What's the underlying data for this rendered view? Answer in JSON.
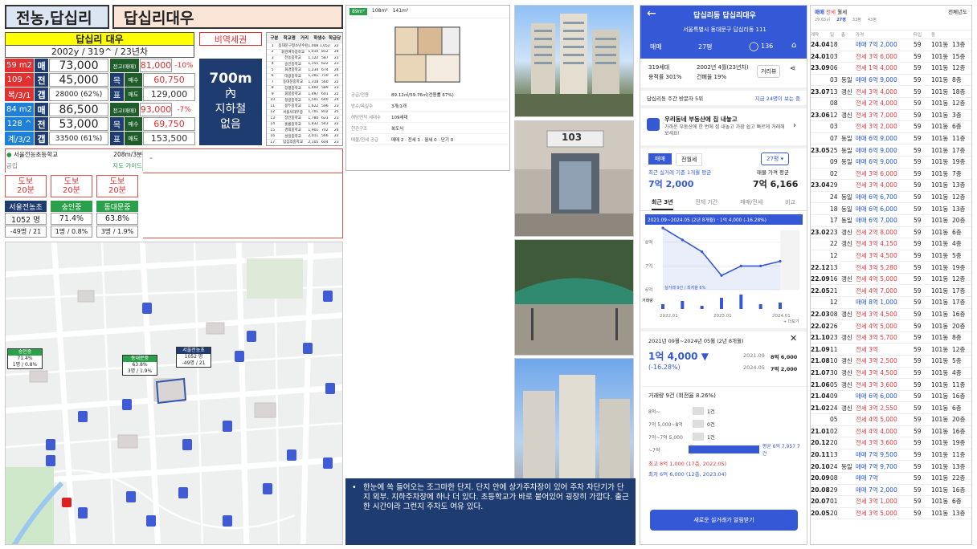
{
  "header": {
    "region": "전농,답십리",
    "apt": "답십리대우"
  },
  "summary": {
    "name": "답십리 대우",
    "meta": "2002y / 319^ / 23년차",
    "station_badge": "비역세권",
    "station_big": "700m",
    "station_line2": "內",
    "station_line3": "지하철",
    "station_line4": "없음"
  },
  "units": [
    {
      "size": "59 m2",
      "hh": "109 ^",
      "layout": "복/3/1",
      "r1": "매",
      "v1": "73,000",
      "r2": "전",
      "v2": "45,000",
      "r3": "갭",
      "v3": "28000 (62%)",
      "peak_label": "전고(매매)",
      "peak": "81,000",
      "pct": "-10%",
      "k2": "목",
      "kl2": "매수",
      "kv2": "60,750",
      "k3": "표",
      "kl3": "매도",
      "kv3": "129,000"
    },
    {
      "size": "84 m2",
      "hh": "128 ^",
      "layout": "계/3/2",
      "r1": "매",
      "v1": "86,500",
      "r2": "전",
      "v2": "53,000",
      "r3": "갭",
      "v3": "33500 (61%)",
      "peak_label": "전고(매매)",
      "peak": "93,000",
      "pct": "-7%",
      "k2": "목",
      "kl2": "매수",
      "kv2": "69,750",
      "k3": "표",
      "kl3": "매도",
      "kv3": "153,500"
    }
  ],
  "school": {
    "name": "서울전농초등학교",
    "type": "공립",
    "dist": "208m/3분",
    "link": "지도 가이드",
    "dash": "-"
  },
  "walk": [
    "도보\n20분",
    "도보\n20분",
    "도보\n20분"
  ],
  "schools": [
    {
      "name": "서울전농초",
      "count": "1052 명",
      "delta": "-49명 / 21"
    },
    {
      "name": "숭인중",
      "count": "71.4%",
      "delta": "1명 / 0.8%"
    },
    {
      "name": "동대문중",
      "count": "63.8%",
      "delta": "3명 / 1.9%"
    }
  ],
  "map": {
    "label1_name": "숭인중",
    "label1_a": "71.4%",
    "label1_b": "1명 / 0.8%",
    "label2_name": "동대문중",
    "label2_a": "63.8%",
    "label2_b": "3명 / 1.9%",
    "label3_name": "서울전농초",
    "label3_a": "1052 명",
    "label3_b": "-49명 / 21"
  },
  "floorplan": {
    "tab1": "89m²",
    "tab2": "108m²",
    "tab3": "141m²",
    "rows": [
      [
        "공급/전용",
        "89.12㎡/59.76㎡(전용률 67%)"
      ],
      [
        "방수/욕실수",
        "3개/1개"
      ],
      [
        "해당면적 세대수",
        "109세대"
      ],
      [
        "현관구조",
        "복도식"
      ],
      [
        "매물/전세 공급",
        "매매 2 · 전세 1 · 월세 0 · 단기 0"
      ]
    ]
  },
  "school_list": {
    "head": [
      "구분",
      "학교명",
      "거리",
      "학생수",
      "학급당"
    ],
    "rows": [
      [
        "1",
        "동대문구청소년수련관",
        "1,008",
        "1,052",
        "22"
      ],
      [
        "2",
        "휘경여자중학교",
        "1,010",
        "812",
        "24"
      ],
      [
        "3",
        "전농중학교",
        "1,122",
        "587",
        "21"
      ],
      [
        "4",
        "숭인중학교",
        "1,155",
        "622",
        "23"
      ],
      [
        "5",
        "휘경중학교",
        "1,234",
        "674",
        "24"
      ],
      [
        "6",
        "대광중학교",
        "1,301",
        "710",
        "25"
      ],
      [
        "7",
        "동대문중학교",
        "1,318",
        "560",
        "22"
      ],
      [
        "8",
        "장평중학교",
        "1,402",
        "589",
        "23"
      ],
      [
        "9",
        "휘봉중학교",
        "1,497",
        "601",
        "22"
      ],
      [
        "10",
        "청량중학교",
        "1,501",
        "640",
        "24"
      ],
      [
        "11",
        "용두중학교",
        "1,622",
        "596",
        "23"
      ],
      [
        "12",
        "서울사대부중",
        "1,701",
        "812",
        "25"
      ],
      [
        "13",
        "장안중학교",
        "1,780",
        "621",
        "23"
      ],
      [
        "14",
        "홍릉중학교",
        "1,832",
        "543",
        "22"
      ],
      [
        "15",
        "경희중학교",
        "1,901",
        "702",
        "24"
      ],
      [
        "16",
        "성일중학교",
        "2,011",
        "566",
        "22"
      ],
      [
        "17",
        "답십리중학교",
        "2,105",
        "604",
        "23"
      ]
    ]
  },
  "comment": "한눈에 쏙 들어오는 조그마한 단지. 단지 안에 상가주차장이 있어 주차 차단기가 단지 외부. 지하주차장에 하나 더 있다. 초등학교가 바로 붙어있어 굉장히 가깝다. 출근한 시간이라 그런지 주차도 여유 있다.",
  "phone": {
    "title": "답십리동 답십리대우",
    "address": "서울특별시 동대문구 답십리동 111",
    "tabs": [
      "매매",
      "27평",
      "136"
    ],
    "info1": "319세대",
    "info2": "용적률 301%",
    "info3": "2002년 4월(23년차)",
    "info4": "건폐율 19%",
    "info_btn": "거리뷰",
    "visitors": "답십리동 주간 방문자 5위",
    "visitors_link": "지금 24명이 보는 중",
    "banner_title": "우리동네 부동산에 집 내놓고",
    "banner_sub": "가까운 부동산에 한 번에 집 내놓고 가장 쉽고 빠르게 거래해보세요!",
    "seg1": "매매",
    "seg2": "전월세",
    "pyeong": "27평",
    "recent_label": "최근 실거래 기준 1개월 평균",
    "recent_val": "7억 2,000",
    "listing_label": "매물 가격 평균",
    "listing_val": "7억 6,166",
    "ctabs": [
      "최근 3년",
      "전체 기간",
      "매매/전세",
      "비교"
    ],
    "chart_header": "2021.09~2024.05 (2년 8개월) · 1억 4,000 (-16.28%)",
    "y1": "8억",
    "y2": "7억",
    "y3": "6억",
    "x1": "2022.01",
    "x2": "2023.01",
    "x3": "2024.01",
    "legend": "실거래 9건 / 최저율 6%",
    "vol": "거래량",
    "more": "+ 더보기",
    "period": "2021년 09월~2024년 05월 (2년 8개월)",
    "change": "1억 4,000 ▼",
    "change_pct": "(-16.28%)",
    "d1": "2021.09",
    "d1v": "8억 6,000",
    "d2": "2024.05",
    "d2v": "7억 2,000",
    "count_title": "거래량 9건 (회전율 8.26%)",
    "bands": [
      [
        "8억~",
        "1건"
      ],
      [
        "7억 5,000~8억",
        "0건"
      ],
      [
        "7억~7억 5,000",
        "1건"
      ],
      [
        "~7억",
        "평균 6억 7,957 7건"
      ]
    ],
    "hi": "최고 8억 1,000 (17층, 2022.05)",
    "lo": "최저 6억 6,000 (12층, 2023.04)",
    "cta": "새로운 실거래가 알림받기"
  },
  "chart_data": {
    "type": "line",
    "title": "",
    "xlabel": "",
    "ylabel": "",
    "x": [
      "2021.09",
      "2022.05",
      "2022.12",
      "2023.04",
      "2023.09",
      "2024.01",
      "2024.05"
    ],
    "series": [
      {
        "name": "매매",
        "values": [
          8.6,
          8.1,
          7.6,
          6.6,
          7.0,
          7.0,
          7.2
        ]
      }
    ],
    "ylim": [
      6,
      8.5
    ]
  },
  "trades": {
    "tabs": [
      "매매",
      "전세",
      "월세"
    ],
    "filter": "전체년도",
    "sizes": [
      "29.65㎡",
      "27평",
      "33평",
      "43평"
    ],
    "head": [
      "계약",
      "일",
      "층",
      "가격",
      "타입",
      "동"
    ],
    "rows": [
      [
        "24.04",
        "18",
        "",
        "매매 7억 2,000",
        "59",
        "101동",
        "13층"
      ],
      [
        "24.01",
        "03",
        "",
        "전세 3억 6,000",
        "59",
        "101동",
        "15층"
      ],
      [
        "23.09",
        "06",
        "",
        "전세 1억 4,000",
        "59",
        "101동",
        "12층"
      ],
      [
        "",
        "03",
        "동일",
        "매매 6억 9,000",
        "59",
        "101동",
        "8층"
      ],
      [
        "23.07",
        "13",
        "갱신",
        "전세 3억 4,000",
        "59",
        "101동",
        "18층"
      ],
      [
        "",
        "08",
        "",
        "전세 2억 4,000",
        "59",
        "101동",
        "12층"
      ],
      [
        "23.06",
        "12",
        "갱신",
        "전세 3억 7,000",
        "59",
        "101동",
        "3층"
      ],
      [
        "",
        "03",
        "",
        "전세 3억 2,000",
        "59",
        "101동",
        "6층"
      ],
      [
        "",
        "07",
        "동일",
        "매매 6억 9,000",
        "59",
        "101동",
        "11층"
      ],
      [
        "23.05",
        "25",
        "동일",
        "매매 6억 9,000",
        "59",
        "101동",
        "17층"
      ],
      [
        "",
        "09",
        "동일",
        "매매 6억 9,000",
        "59",
        "101동",
        "19층"
      ],
      [
        "",
        "02",
        "",
        "전세 3억 6,000",
        "59",
        "101동",
        "7층"
      ],
      [
        "23.04",
        "29",
        "",
        "전세 3억 4,000",
        "59",
        "101동",
        "13층"
      ],
      [
        "",
        "24",
        "동일",
        "매매 6억 6,700",
        "59",
        "101동",
        "12층"
      ],
      [
        "",
        "18",
        "동일",
        "매매 6억 6,000",
        "59",
        "101동",
        "13층"
      ],
      [
        "",
        "17",
        "동일",
        "매매 6억 7,000",
        "59",
        "101동",
        "20층"
      ],
      [
        "23.02",
        "23",
        "갱신",
        "전세 2억 8,000",
        "59",
        "101동",
        "6층"
      ],
      [
        "",
        "22",
        "갱신",
        "전세 3억 4,150",
        "59",
        "101동",
        "4층"
      ],
      [
        "",
        "12",
        "",
        "전세 3억 4,500",
        "59",
        "101동",
        "5층"
      ],
      [
        "22.12",
        "13",
        "",
        "전세 3억 5,280",
        "59",
        "101동",
        "19층"
      ],
      [
        "22.09",
        "16",
        "갱신",
        "전세 4억 5,000",
        "59",
        "101동",
        "12층"
      ],
      [
        "22.05",
        "21",
        "",
        "전세 4억 7,000",
        "59",
        "101동",
        "17층"
      ],
      [
        "",
        "12",
        "",
        "매매 8억 1,000",
        "59",
        "101동",
        "17층"
      ],
      [
        "22.03",
        "08",
        "갱신",
        "전세 3억 4,500",
        "59",
        "101동",
        "16층"
      ],
      [
        "22.02",
        "26",
        "",
        "전세 4억 5,000",
        "59",
        "101동",
        "20층"
      ],
      [
        "21.10",
        "23",
        "갱신",
        "전세 3억 5,700",
        "59",
        "101동",
        "8층"
      ],
      [
        "21.09",
        "11",
        "",
        "전세 3억",
        "59",
        "101동",
        "12층"
      ],
      [
        "21.08",
        "10",
        "갱신",
        "전세 3억 2,500",
        "59",
        "101동",
        "5층"
      ],
      [
        "21.07",
        "30",
        "갱신",
        "전세 3억 4,500",
        "59",
        "101동",
        "4층"
      ],
      [
        "21.06",
        "05",
        "갱신",
        "전세 3억 3,600",
        "59",
        "101동",
        "11층"
      ],
      [
        "21.04",
        "09",
        "",
        "매매 6억 6,000",
        "59",
        "101동",
        "16층"
      ],
      [
        "21.02",
        "24",
        "갱신",
        "전세 3억 2,550",
        "59",
        "101동",
        "6층"
      ],
      [
        "",
        "05",
        "",
        "전세 4억 5,000",
        "59",
        "101동",
        "20층"
      ],
      [
        "21.01",
        "02",
        "",
        "전세 4억 4,000",
        "59",
        "101동",
        "16층"
      ],
      [
        "20.12",
        "20",
        "",
        "전세 3억 3,600",
        "59",
        "101동",
        "19층"
      ],
      [
        "20.11",
        "13",
        "",
        "매매 7억 9,500",
        "59",
        "101동",
        "11층"
      ],
      [
        "20.10",
        "24",
        "동일",
        "매매 7억 9,700",
        "59",
        "101동",
        "13층"
      ],
      [
        "20.09",
        "08",
        "",
        "매매 7억",
        "59",
        "101동",
        "22층"
      ],
      [
        "20.08",
        "29",
        "",
        "매매 7억 2,000",
        "59",
        "101동",
        "16층"
      ],
      [
        "20.07",
        "01",
        "",
        "전세 3억 1,000",
        "59",
        "101동",
        "6층"
      ],
      [
        "20.05",
        "20",
        "",
        "전세 3억 5,000",
        "59",
        "101동",
        "13층"
      ]
    ]
  },
  "photos": {
    "sign": "103"
  }
}
